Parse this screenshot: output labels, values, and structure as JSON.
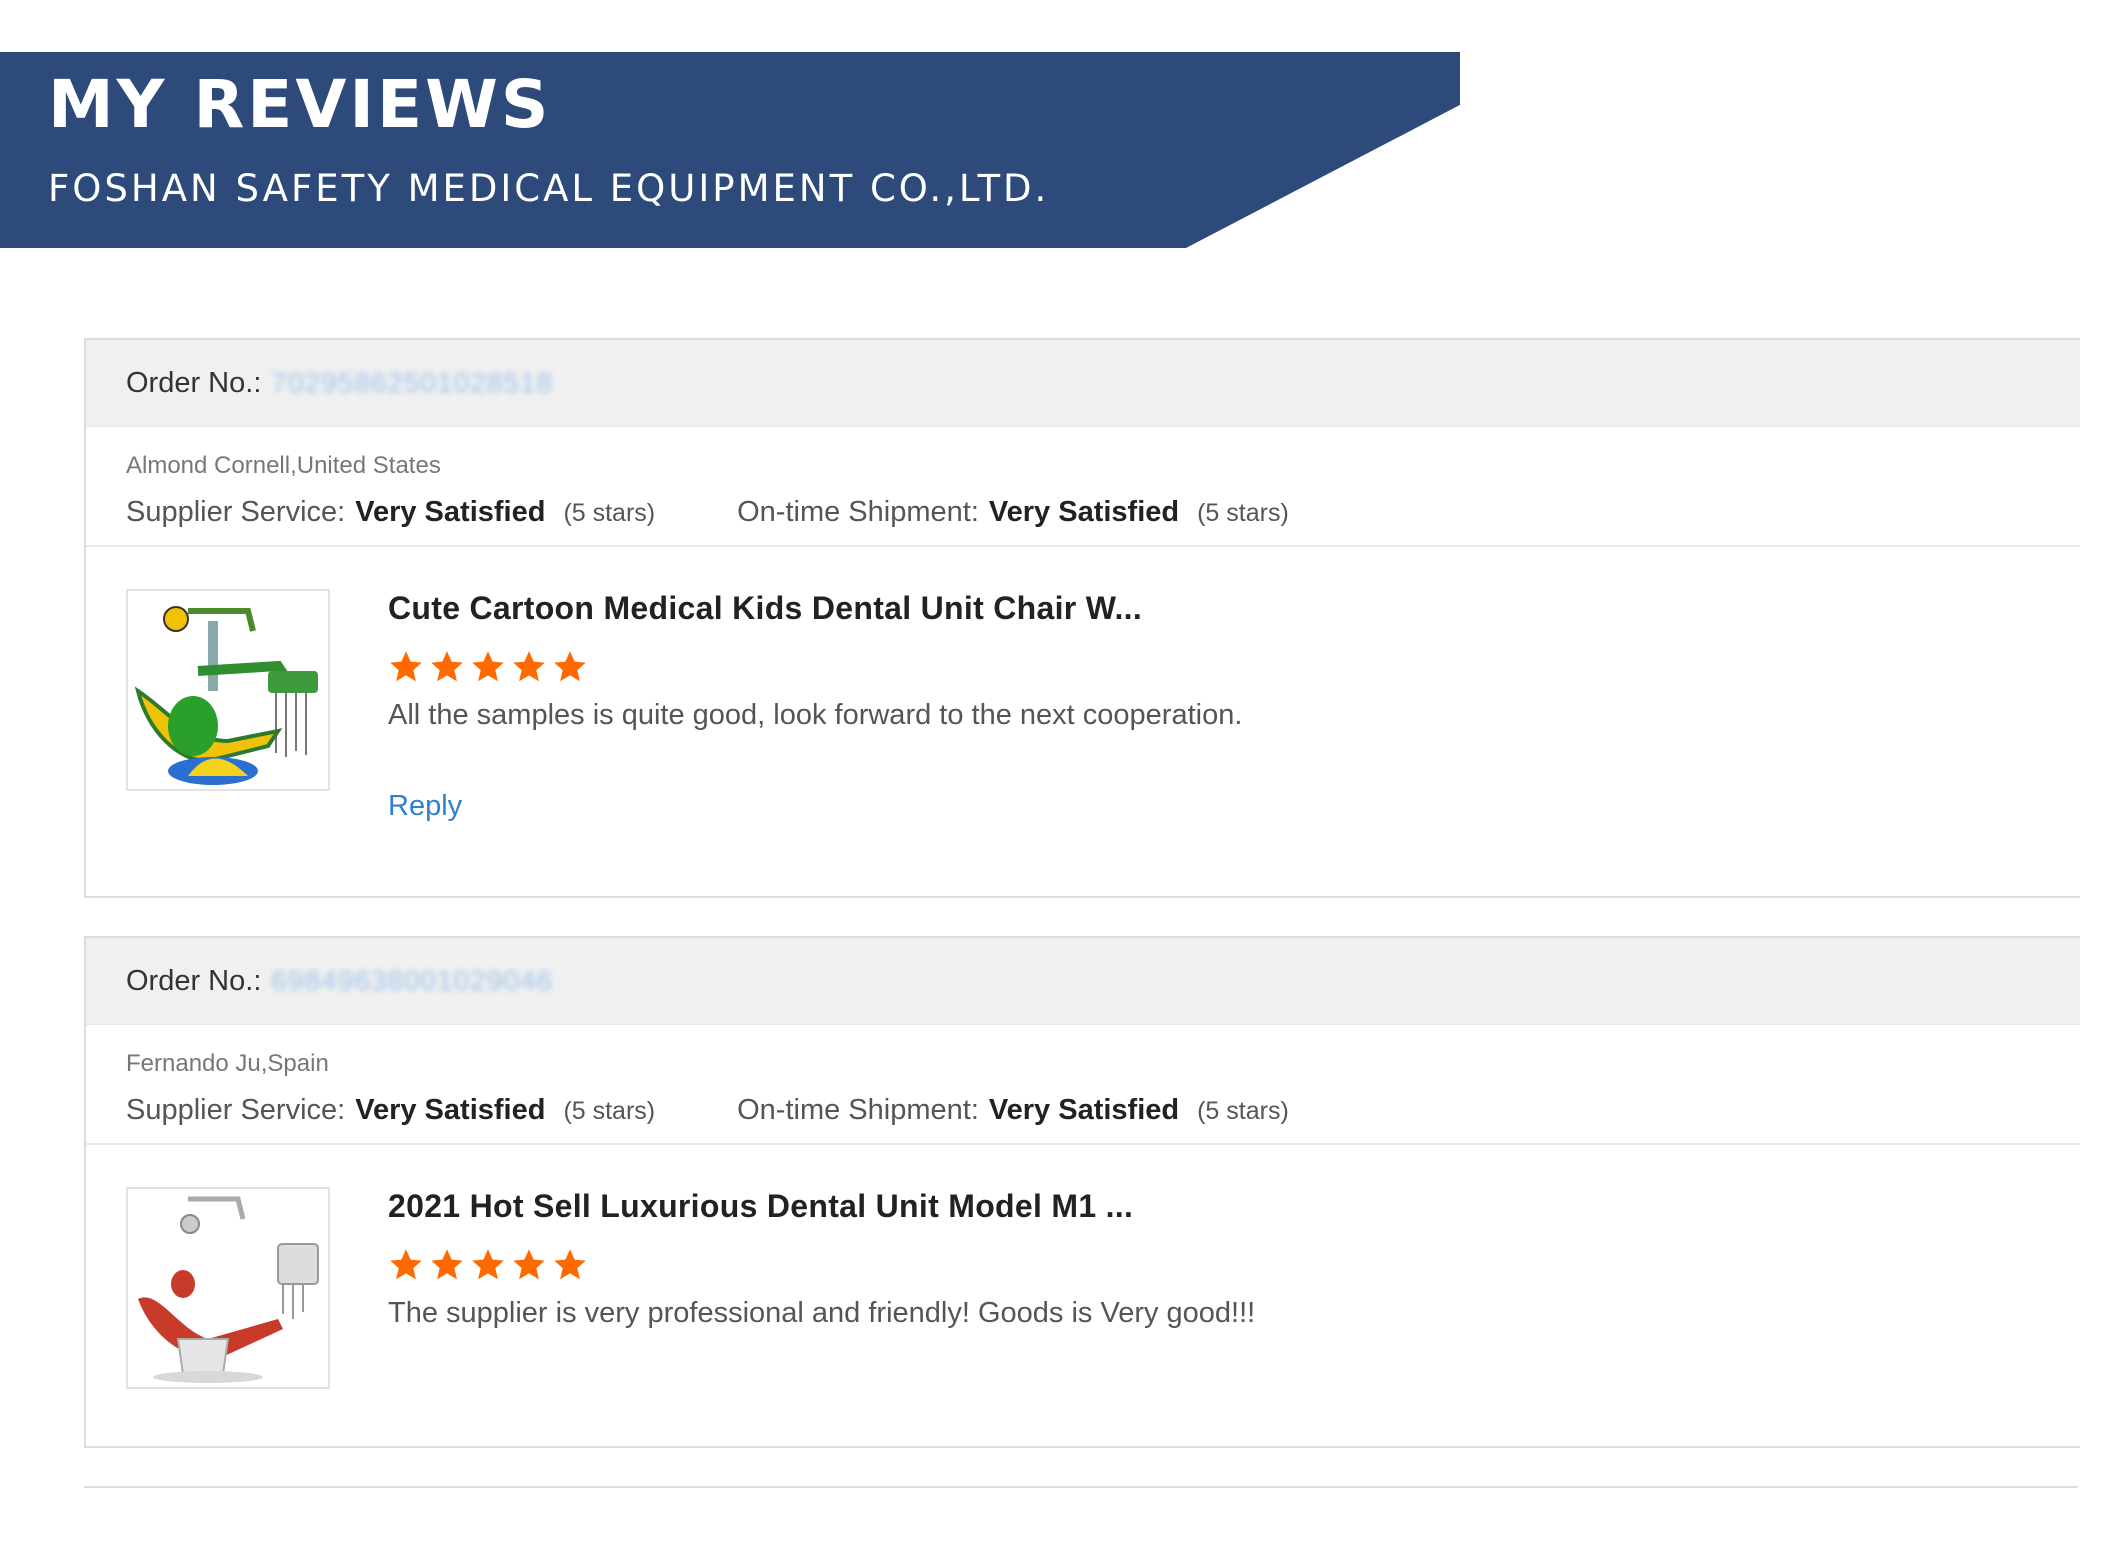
{
  "banner": {
    "title": "MY REVIEWS",
    "subtitle": "FOSHAN SAFETY MEDICAL EQUIPMENT CO.,LTD.",
    "color": "#2d4a7a"
  },
  "reviews": [
    {
      "order_label": "Order No.:",
      "order_number": "70295862501028518",
      "buyer": "Almond Cornell,United States",
      "supplier_service_label": "Supplier Service:",
      "supplier_service_value": "Very Satisfied",
      "supplier_service_stars": "(5 stars)",
      "shipment_label": "On-time Shipment:",
      "shipment_value": "Very Satisfied",
      "shipment_stars": "(5 stars)",
      "product_title": "Cute Cartoon Medical Kids Dental Unit Chair W...",
      "rating": 5,
      "comment": "All the samples is quite good, look forward to the next cooperation.",
      "reply_label": "Reply",
      "thumbnail_icon": "kids-dental-chair-image"
    },
    {
      "order_label": "Order No.:",
      "order_number": "69849638001029046",
      "buyer": "Fernando Ju,Spain",
      "supplier_service_label": "Supplier Service:",
      "supplier_service_value": "Very Satisfied",
      "supplier_service_stars": "(5 stars)",
      "shipment_label": "On-time Shipment:",
      "shipment_value": "Very Satisfied",
      "shipment_stars": "(5 stars)",
      "product_title": "2021 Hot Sell Luxurious Dental Unit Model M1 ...",
      "rating": 5,
      "comment": "The supplier is very professional and friendly! Goods is Very good!!!",
      "thumbnail_icon": "dental-unit-chair-image"
    }
  ],
  "colors": {
    "star": "#ff6a00",
    "link": "#2f7fd1",
    "header_bar": "#f0f0f0"
  }
}
